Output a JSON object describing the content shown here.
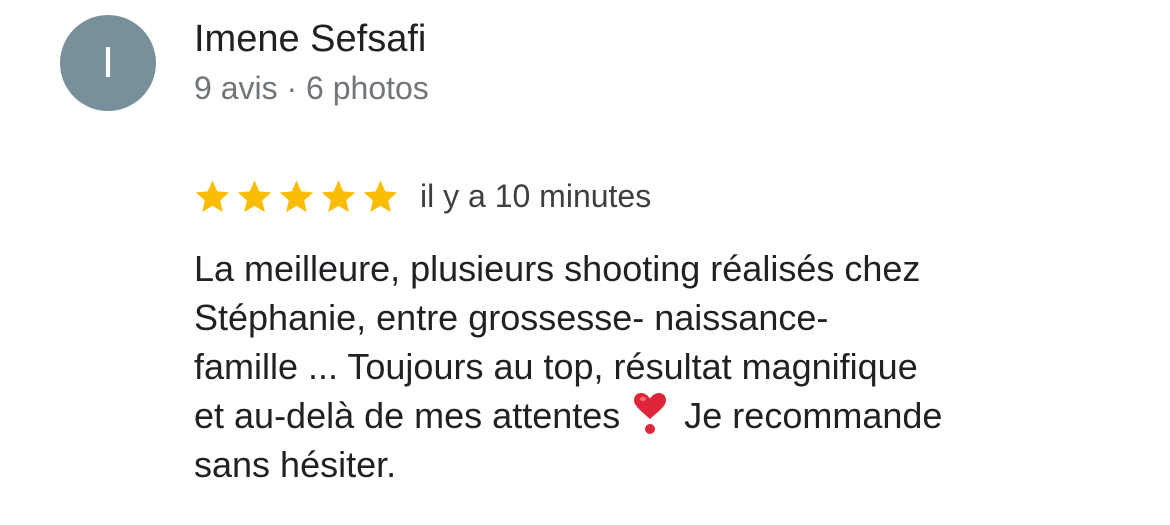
{
  "review": {
    "author": {
      "initial": "I",
      "name": "Imene Sefsafi",
      "meta": "9 avis · 6 photos"
    },
    "rating": {
      "stars": 5,
      "max_stars": 5,
      "star_color": "#fbbc04",
      "time_ago": "il y a 10 minutes"
    },
    "text": {
      "line1": "La meilleure, plusieurs shooting réalisés chez",
      "line2": "Stéphanie, entre grossesse- naissance-",
      "line3": "famille ... Toujours au top, résultat magnifique",
      "line4_before_emoji": "et au-delà de mes attentes ",
      "emoji_icon": "heavy-heart-exclamation-icon",
      "line4_after_emoji": " Je recommande",
      "line5": "sans hésiter."
    },
    "colors": {
      "avatar_bg": "#78909c",
      "heart": "#e0253a"
    }
  }
}
